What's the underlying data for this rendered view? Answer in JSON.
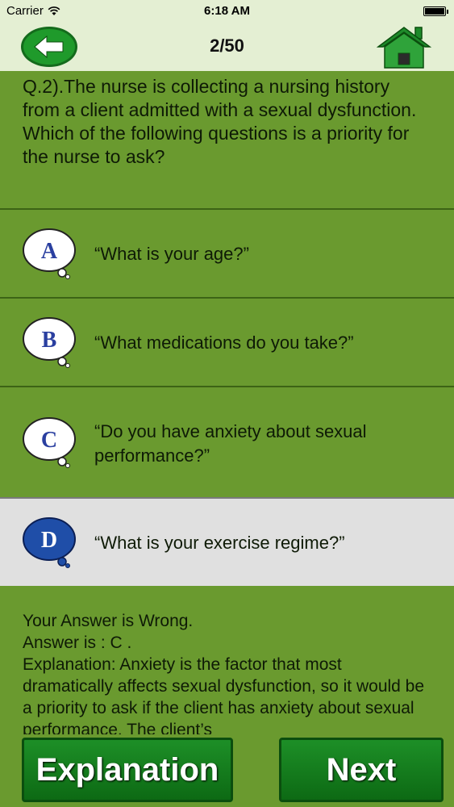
{
  "status": {
    "carrier": "Carrier",
    "time": "6:18 AM"
  },
  "nav": {
    "progress": "2/50"
  },
  "question": {
    "text": "Q.2).The nurse is collecting a nursing history from a client admitted with a sexual dysfunction. Which of the following questions is a priority for the nurse to ask?"
  },
  "options": [
    {
      "letter": "A",
      "text": "“What is your age?”"
    },
    {
      "letter": "B",
      "text": "“What medications do you take?”"
    },
    {
      "letter": "C",
      "text": "“Do you have anxiety about sexual performance?”"
    },
    {
      "letter": "D",
      "text": "“What is your exercise regime?”",
      "selected": true
    }
  ],
  "result": {
    "verdict": "Your Answer is Wrong.",
    "answer": "Answer is : C .",
    "explanation": "Explanation: Anxiety is the factor that most dramatically affects sexual dysfunction, so it would be a priority to ask if the client has anxiety about sexual performance. The client’s"
  },
  "buttons": {
    "explanation": "Explanation",
    "next": "Next"
  },
  "colors": {
    "background": "#6a9a2f",
    "bar": "#e4efd3",
    "button": "#1d8f27",
    "selected": "#e0e0e0",
    "bubble_selected": "#1f4ea8"
  }
}
